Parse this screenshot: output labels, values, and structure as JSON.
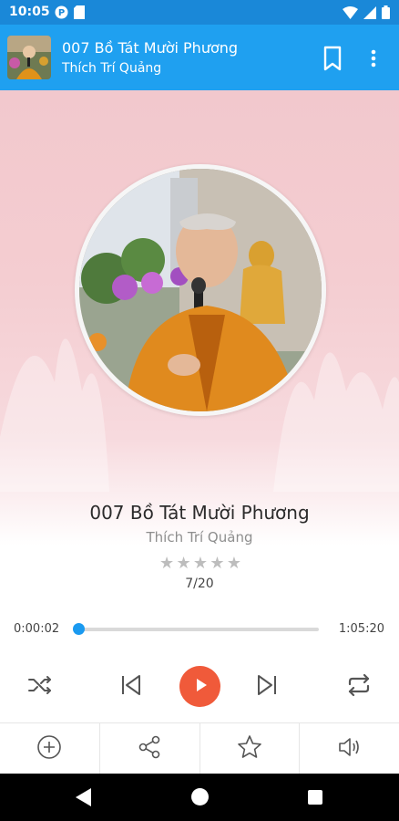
{
  "status_bar": {
    "time": "10:05",
    "icons": [
      "p-badge-icon",
      "sd-card-icon",
      "wifi-icon",
      "cellular-signal-icon",
      "battery-icon"
    ]
  },
  "app_bar": {
    "title": "007 Bồ Tát Mười Phương",
    "subtitle": "Thích Trí Quảng",
    "actions": [
      "bookmark-icon",
      "more-vert-icon"
    ],
    "background_color": "#1fa0f0"
  },
  "player": {
    "track_title": "007 Bồ Tát Mười Phương",
    "artist": "Thích Trí Quảng",
    "rating_stars": 5,
    "rating_value": 0,
    "position_text": "7/20",
    "time_current": "0:00:02",
    "time_total": "1:05:20",
    "progress_fraction": 0.0005,
    "accent_color": "#1a9af0",
    "play_button_color": "#f05a3a",
    "controls": [
      "shuffle-icon",
      "previous-icon",
      "play-icon",
      "next-icon",
      "repeat-icon"
    ]
  },
  "bottom_bar": {
    "items": [
      "add-circle-icon",
      "share-icon",
      "star-outline-icon",
      "volume-icon"
    ]
  },
  "nav_bar": {
    "items": [
      "back-icon",
      "home-icon",
      "recents-icon"
    ]
  }
}
